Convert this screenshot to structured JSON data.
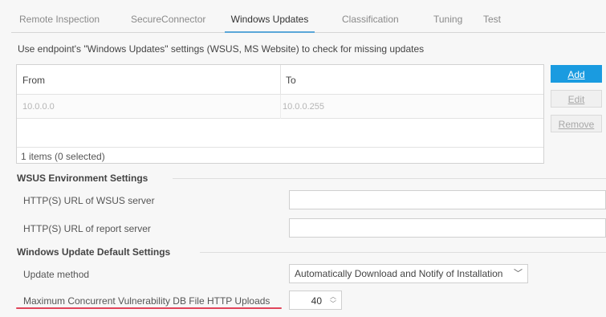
{
  "tabs": [
    {
      "label": "Remote Inspection",
      "active": false
    },
    {
      "label": "SecureConnector",
      "active": false
    },
    {
      "label": "Windows Updates",
      "active": true
    },
    {
      "label": "Classification",
      "active": false
    },
    {
      "label": "Tuning",
      "active": false
    },
    {
      "label": "Test",
      "active": false
    }
  ],
  "instruction": "Use endpoint's \"Windows Updates\" settings (WSUS, MS Website) to check for missing updates",
  "table": {
    "headers": [
      "From",
      "To"
    ],
    "rows": [
      {
        "from": "10.0.0.0",
        "to": "10.0.0.255"
      }
    ],
    "footer": "1 items (0 selected)"
  },
  "buttons": {
    "add": "Add",
    "edit": "Edit",
    "remove": "Remove"
  },
  "wsus": {
    "title": "WSUS Environment Settings",
    "server_label": "HTTP(S) URL of WSUS server",
    "server_value": "",
    "report_label": "HTTP(S) URL of report server",
    "report_value": ""
  },
  "defaults": {
    "title": "Windows Update Default Settings",
    "method_label": "Update method",
    "method_value": "Automatically Download and Notify of Installation",
    "uploads_label": "Maximum Concurrent Vulnerability DB File HTTP Uploads",
    "uploads_value": "40"
  },
  "colors": {
    "accent": "#1a9be0",
    "highlight": "#e0455a"
  }
}
